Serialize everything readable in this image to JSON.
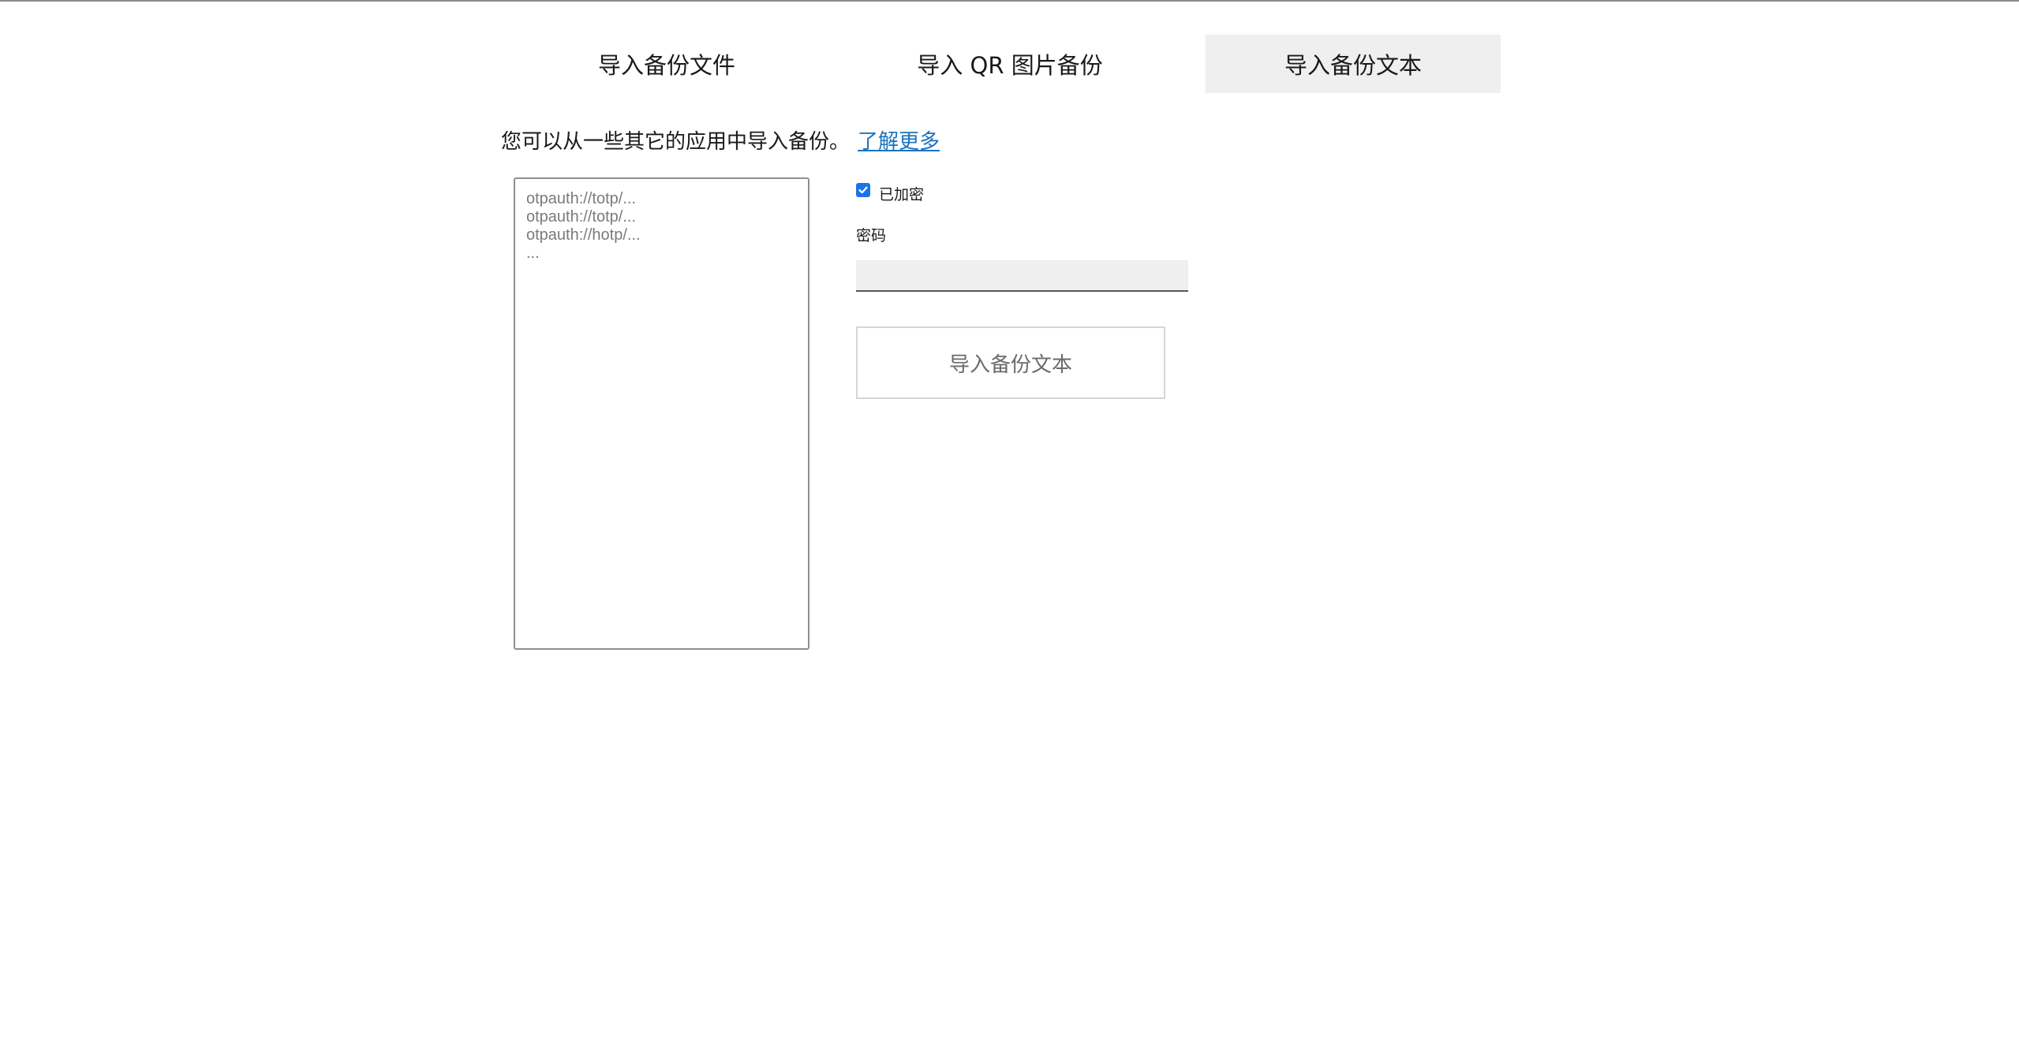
{
  "tabs": [
    {
      "label": "导入备份文件",
      "active": false
    },
    {
      "label": "导入 QR 图片备份",
      "active": false
    },
    {
      "label": "导入备份文本",
      "active": true
    }
  ],
  "intro": {
    "text": "您可以从一些其它的应用中导入备份。",
    "link_label": "了解更多"
  },
  "backup_text": {
    "value": "",
    "placeholder": "otpauth://totp/...\notpauth://totp/...\notpauth://hotp/...\n..."
  },
  "encrypted": {
    "label": "已加密",
    "checked": true,
    "color": "#1a73e8"
  },
  "password": {
    "label": "密码",
    "value": ""
  },
  "import_button": {
    "label": "导入备份文本"
  }
}
